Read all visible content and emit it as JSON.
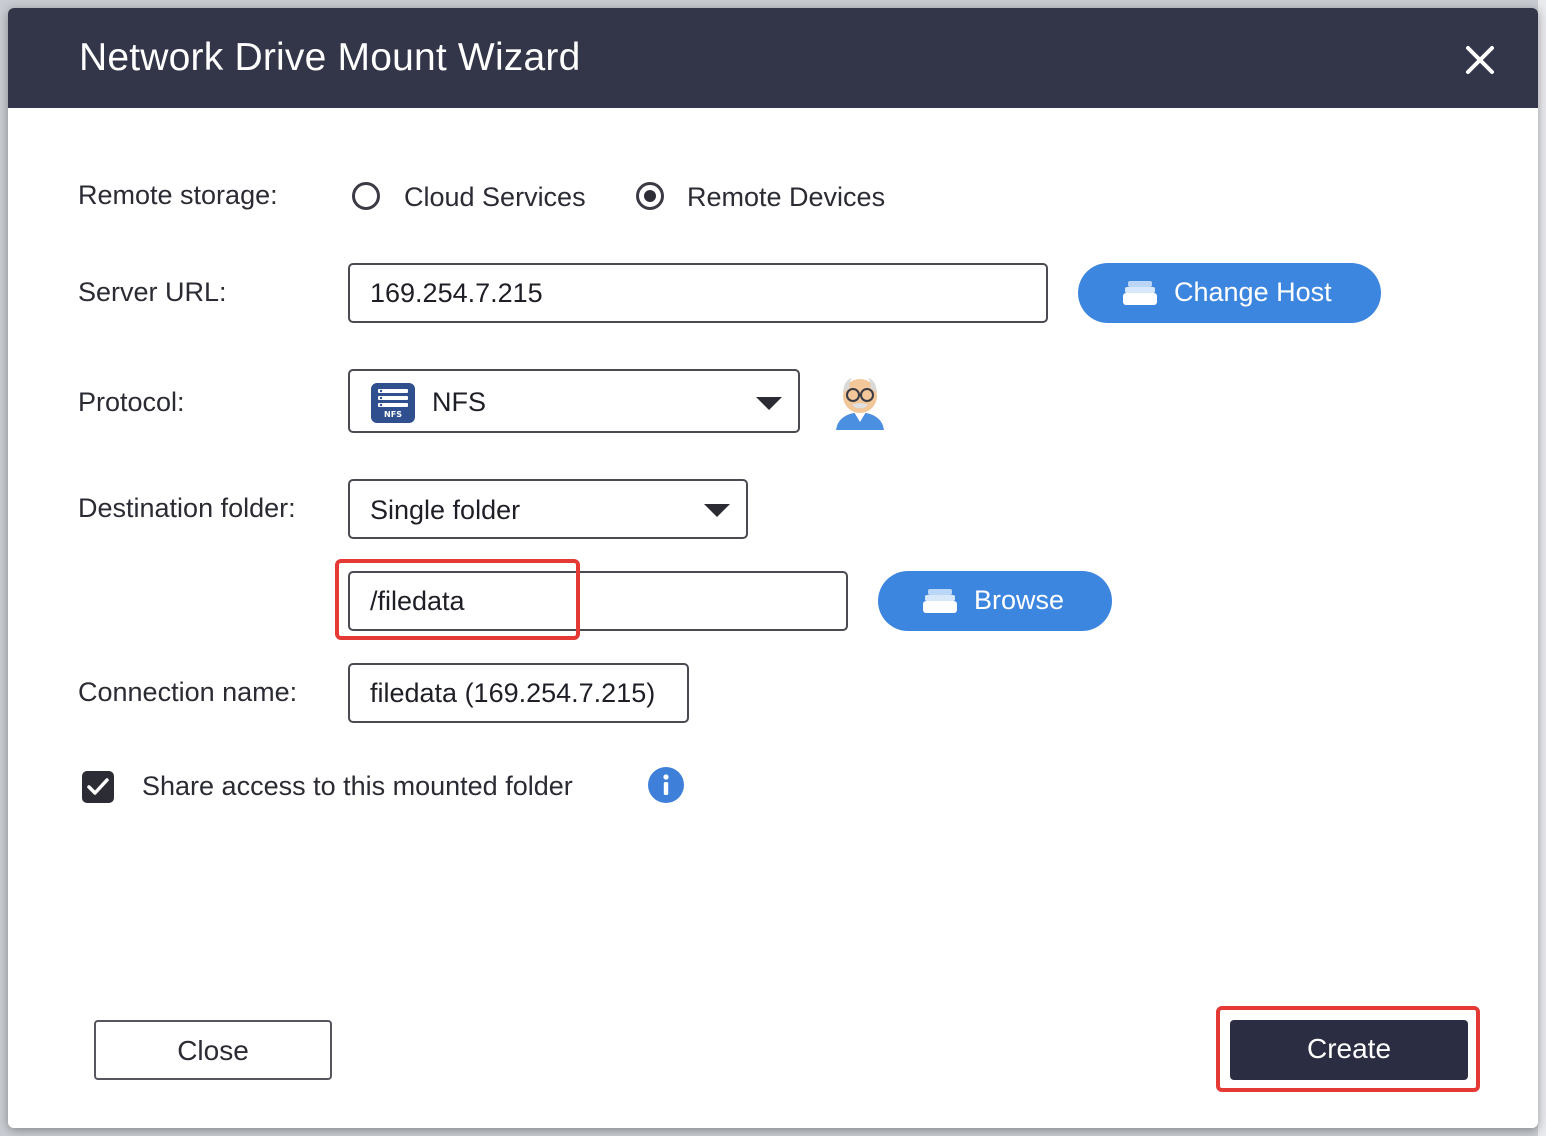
{
  "dialog": {
    "title": "Network Drive Mount Wizard",
    "close_icon": "close-icon"
  },
  "remote_storage": {
    "label": "Remote storage:",
    "options": [
      {
        "label": "Cloud Services",
        "selected": false
      },
      {
        "label": "Remote Devices",
        "selected": true
      }
    ]
  },
  "server_url": {
    "label": "Server URL:",
    "value": "169.254.7.215",
    "change_host_label": "Change Host"
  },
  "protocol": {
    "label": "Protocol:",
    "selected": "NFS",
    "icon_badge": "NFS"
  },
  "destination": {
    "label": "Destination folder:",
    "mode": "Single folder",
    "path": "/filedata",
    "browse_label": "Browse"
  },
  "connection": {
    "label": "Connection name:",
    "value": "filedata (169.254.7.215)"
  },
  "share_access": {
    "label": "Share access to this mounted folder",
    "checked": true
  },
  "footer": {
    "close_label": "Close",
    "create_label": "Create"
  },
  "colors": {
    "titlebar": "#333548",
    "accent_blue": "#3d86e0",
    "create_button": "#2b2d42",
    "highlight_red": "#e53935"
  }
}
